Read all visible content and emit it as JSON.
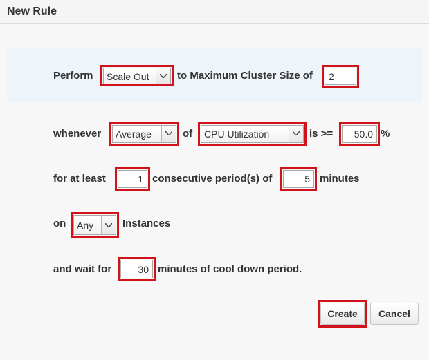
{
  "window": {
    "title": "New Rule"
  },
  "row1": {
    "perform_label": "Perform",
    "action_select": "Scale Out",
    "to_label": "to Maximum Cluster Size of",
    "max_size_value": "2"
  },
  "row2": {
    "whenever_label": "whenever",
    "statistic_select": "Average",
    "of_label": "of",
    "metric_select": "CPU Utilization",
    "operator_label": "is >=",
    "threshold_value": "50.0",
    "percent_label": "%"
  },
  "row3": {
    "for_label": "for at least",
    "periods_value": "1",
    "consecutive_label": "consecutive period(s) of",
    "minutes_value": "5",
    "minutes_label": "minutes"
  },
  "row4": {
    "on_label": "on",
    "instances_select": "Any",
    "instances_label": "Instances"
  },
  "row5": {
    "wait_label": "and wait for",
    "cooldown_value": "30",
    "cooldown_label": "minutes of cool down period."
  },
  "buttons": {
    "create": "Create",
    "cancel": "Cancel"
  },
  "colors": {
    "highlight": "#d1121b",
    "band": "#eef5fa"
  },
  "icons": {
    "dropdown": "chevron-down-icon"
  }
}
